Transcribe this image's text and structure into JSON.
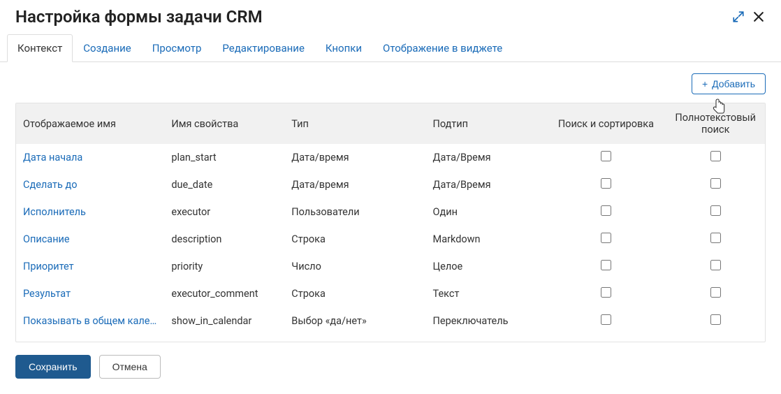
{
  "title": "Настройка формы задачи CRM",
  "tabs": [
    {
      "label": "Контекст",
      "active": true
    },
    {
      "label": "Создание",
      "active": false
    },
    {
      "label": "Просмотр",
      "active": false
    },
    {
      "label": "Редактирование",
      "active": false
    },
    {
      "label": "Кнопки",
      "active": false
    },
    {
      "label": "Отображение в виджете",
      "active": false
    }
  ],
  "toolbar": {
    "add_label": "Добавить"
  },
  "columns": {
    "display": "Отображаемое имя",
    "prop": "Имя свойства",
    "type": "Тип",
    "subtype": "Подтип",
    "search": "Поиск и сортировка",
    "fulltext": "Полнотекстовый поиск"
  },
  "rows": [
    {
      "display": "Дата начала",
      "prop": "plan_start",
      "type": "Дата/время",
      "subtype": "Дата/Время",
      "search": false,
      "fulltext": false
    },
    {
      "display": "Сделать до",
      "prop": "due_date",
      "type": "Дата/время",
      "subtype": "Дата/Время",
      "search": false,
      "fulltext": false
    },
    {
      "display": "Исполнитель",
      "prop": "executor",
      "type": "Пользователи",
      "subtype": "Один",
      "search": false,
      "fulltext": false
    },
    {
      "display": "Описание",
      "prop": "description",
      "type": "Строка",
      "subtype": "Markdown",
      "search": false,
      "fulltext": false
    },
    {
      "display": "Приоритет",
      "prop": "priority",
      "type": "Число",
      "subtype": "Целое",
      "search": false,
      "fulltext": false
    },
    {
      "display": "Результат",
      "prop": "executor_comment",
      "type": "Строка",
      "subtype": "Текст",
      "search": false,
      "fulltext": false
    },
    {
      "display": "Показывать в общем кален...",
      "prop": "show_in_calendar",
      "type": "Выбор «да/нет»",
      "subtype": "Переключатель",
      "search": false,
      "fulltext": false
    }
  ],
  "footer": {
    "save": "Сохранить",
    "cancel": "Отмена"
  }
}
